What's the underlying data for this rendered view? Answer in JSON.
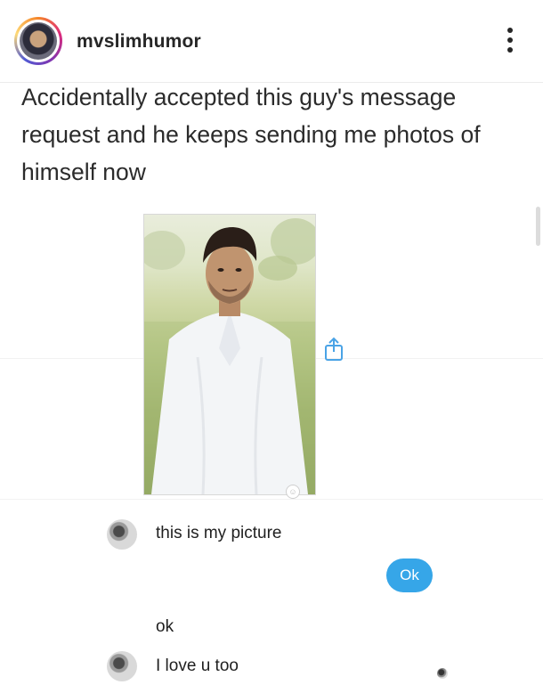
{
  "header": {
    "username": "mvslimhumor",
    "avatar_icon": "profile-avatar",
    "more_icon": "three-dots-vertical-icon"
  },
  "post": {
    "caption": "Accidentally accepted this guy's message request and he keeps sending me photos of himself now"
  },
  "chat": {
    "photo_icon": "shared-photo",
    "share_icon": "share-icon",
    "messages": [
      {
        "from": "them",
        "text": "this is my picture"
      },
      {
        "from": "me",
        "text": "Ok"
      },
      {
        "from": "them",
        "text": "ok"
      },
      {
        "from": "them",
        "text": "I love u too"
      }
    ]
  },
  "colors": {
    "sent_bubble": "#36a6e8",
    "text": "#262626",
    "background": "#ffffff"
  }
}
